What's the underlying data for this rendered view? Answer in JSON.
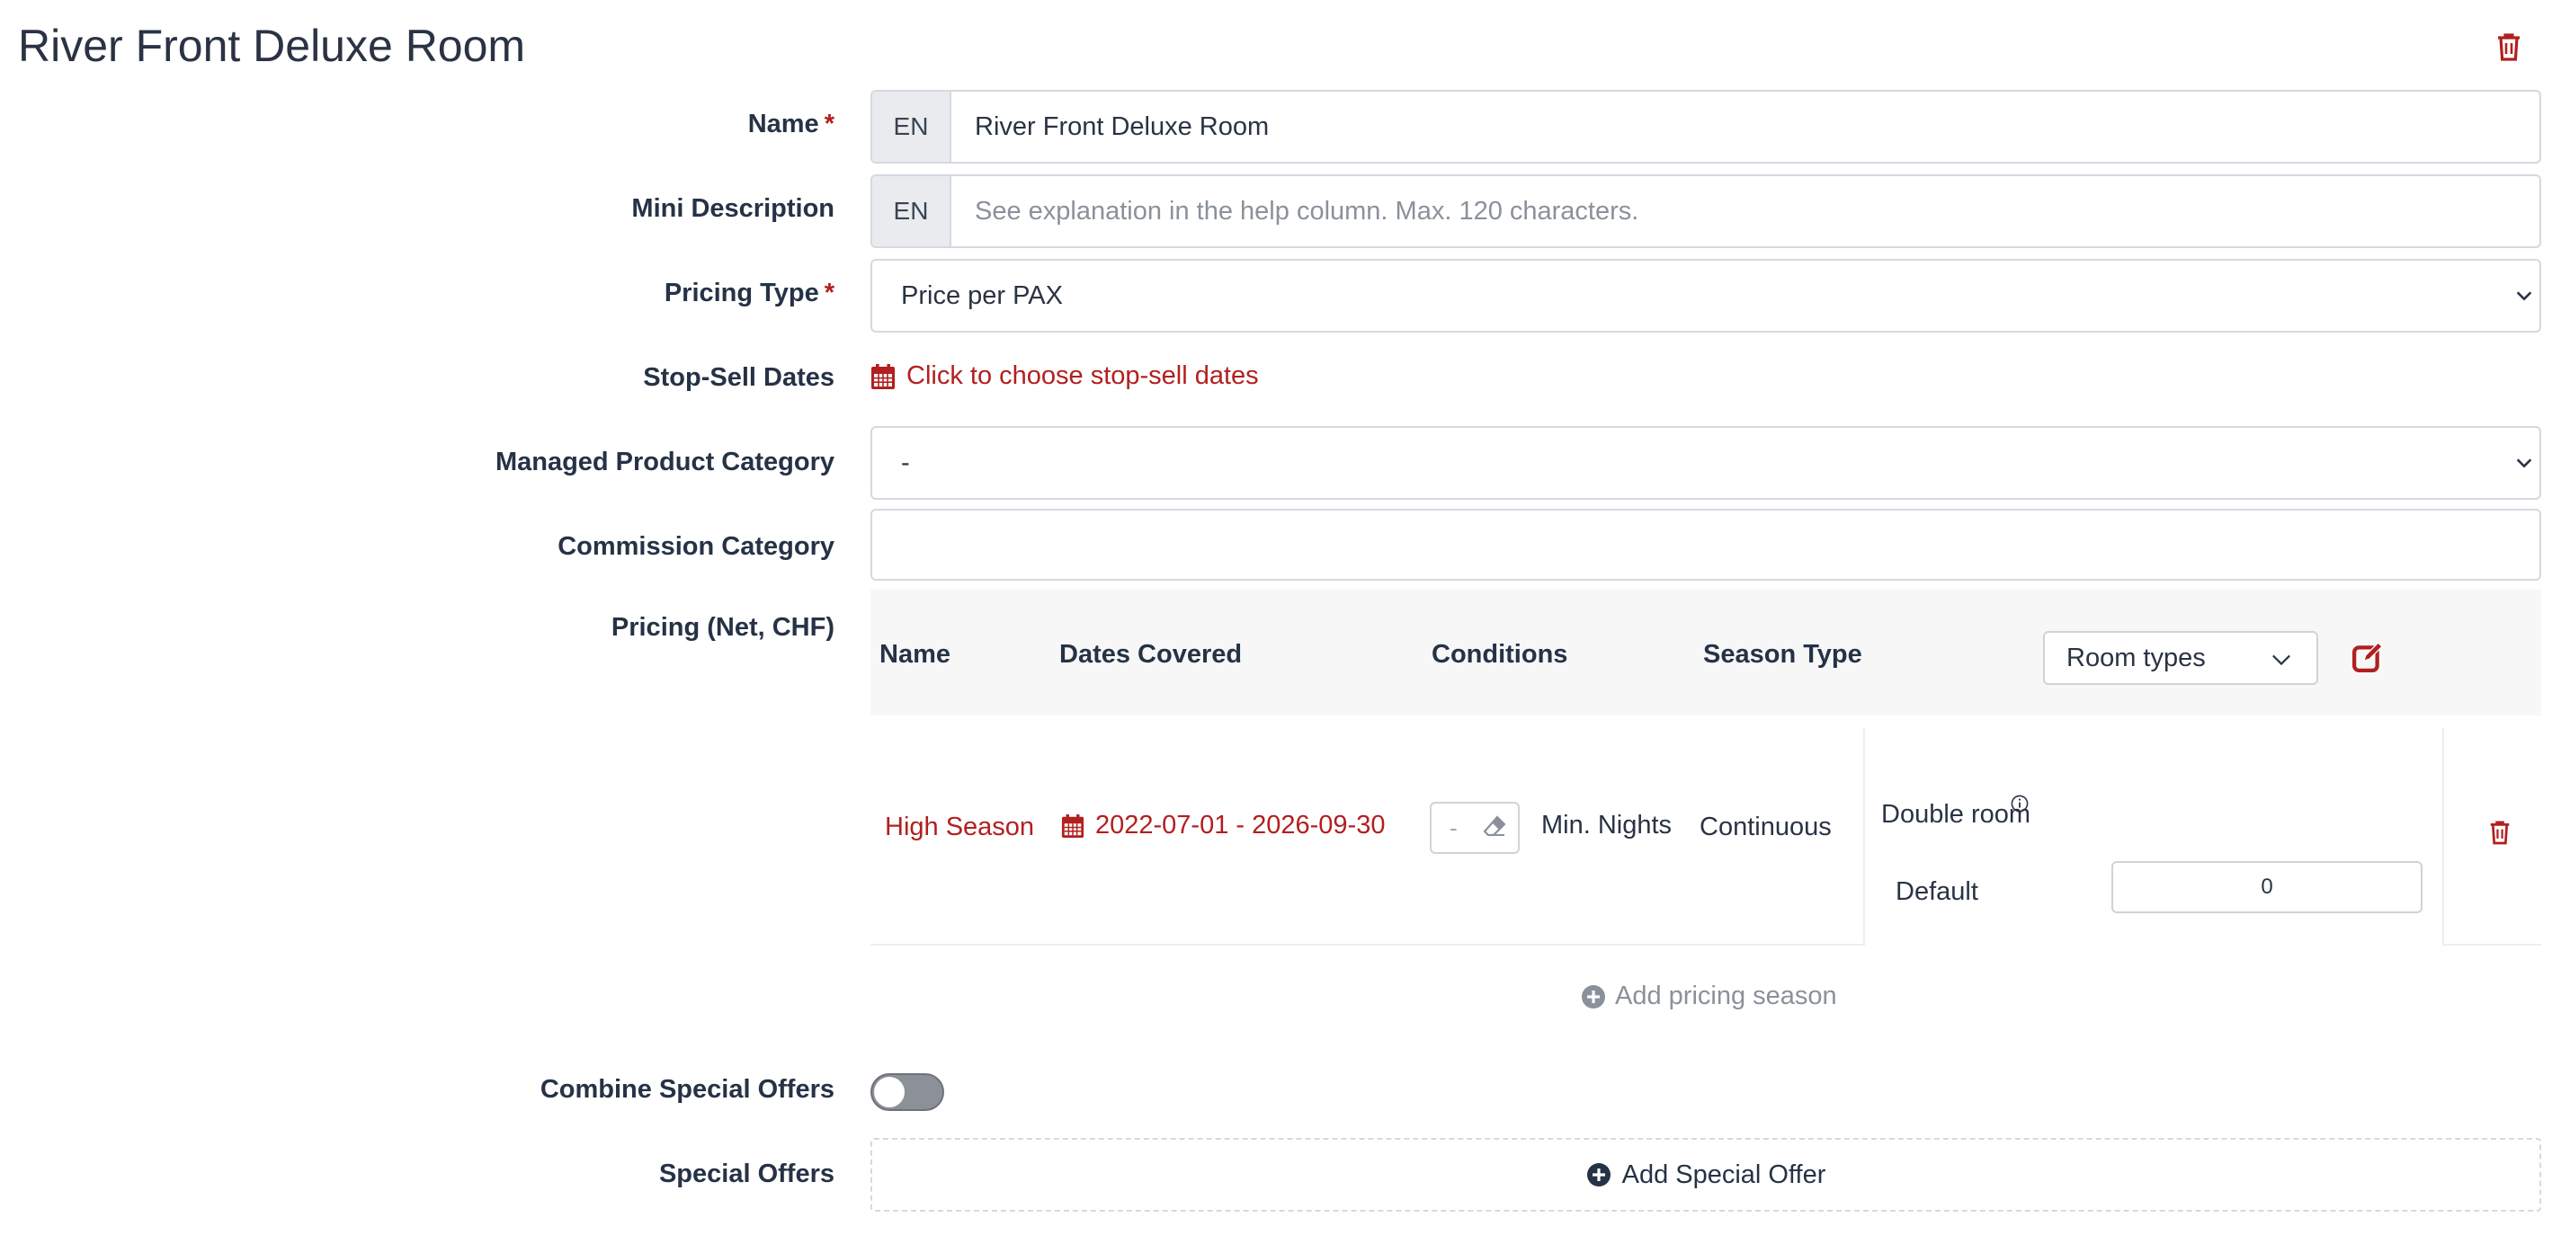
{
  "page": {
    "title": "River Front Deluxe Room"
  },
  "colors": {
    "accent_red": "#b21f1f",
    "muted": "#8a919b",
    "label": "#263245"
  },
  "fields": {
    "name": {
      "label": "Name",
      "required_mark": "*",
      "lang": "EN",
      "value": "River Front Deluxe Room"
    },
    "mini_description": {
      "label": "Mini Description",
      "lang": "EN",
      "value": "",
      "placeholder": "See explanation in the help column. Max. 120 characters."
    },
    "pricing_type": {
      "label": "Pricing Type",
      "required_mark": "*",
      "selected": "Price per PAX"
    },
    "stop_sell": {
      "label": "Stop-Sell Dates",
      "link": "Click to choose stop-sell dates"
    },
    "managed_product_category": {
      "label": "Managed Product Category",
      "selected": "-"
    },
    "commission_category": {
      "label": "Commission Category",
      "value": ""
    },
    "pricing": {
      "label": "Pricing (Net, CHF)"
    },
    "combine_special_offers": {
      "label": "Combine Special Offers",
      "enabled": false
    },
    "special_offers": {
      "label": "Special Offers",
      "add_label": "Add Special Offer"
    }
  },
  "pricing_table": {
    "columns": [
      "Name",
      "Dates Covered",
      "Conditions",
      "Season Type"
    ],
    "room_types_selected": "Room types",
    "rows": [
      {
        "name": "High Season",
        "dates": "2022-07-01 - 2026-09-30",
        "min_nights_value": "-",
        "min_nights_label": "Min. Nights",
        "season_type": "Continuous",
        "room_type": "Double room",
        "rate_label": "Default",
        "rate_value": "0"
      }
    ],
    "add_season_label": "Add pricing season"
  },
  "icons": [
    "trash-icon",
    "calendar-icon",
    "chevron-down-icon",
    "edit-icon",
    "eraser-icon",
    "info-icon",
    "plus-circle-icon"
  ]
}
